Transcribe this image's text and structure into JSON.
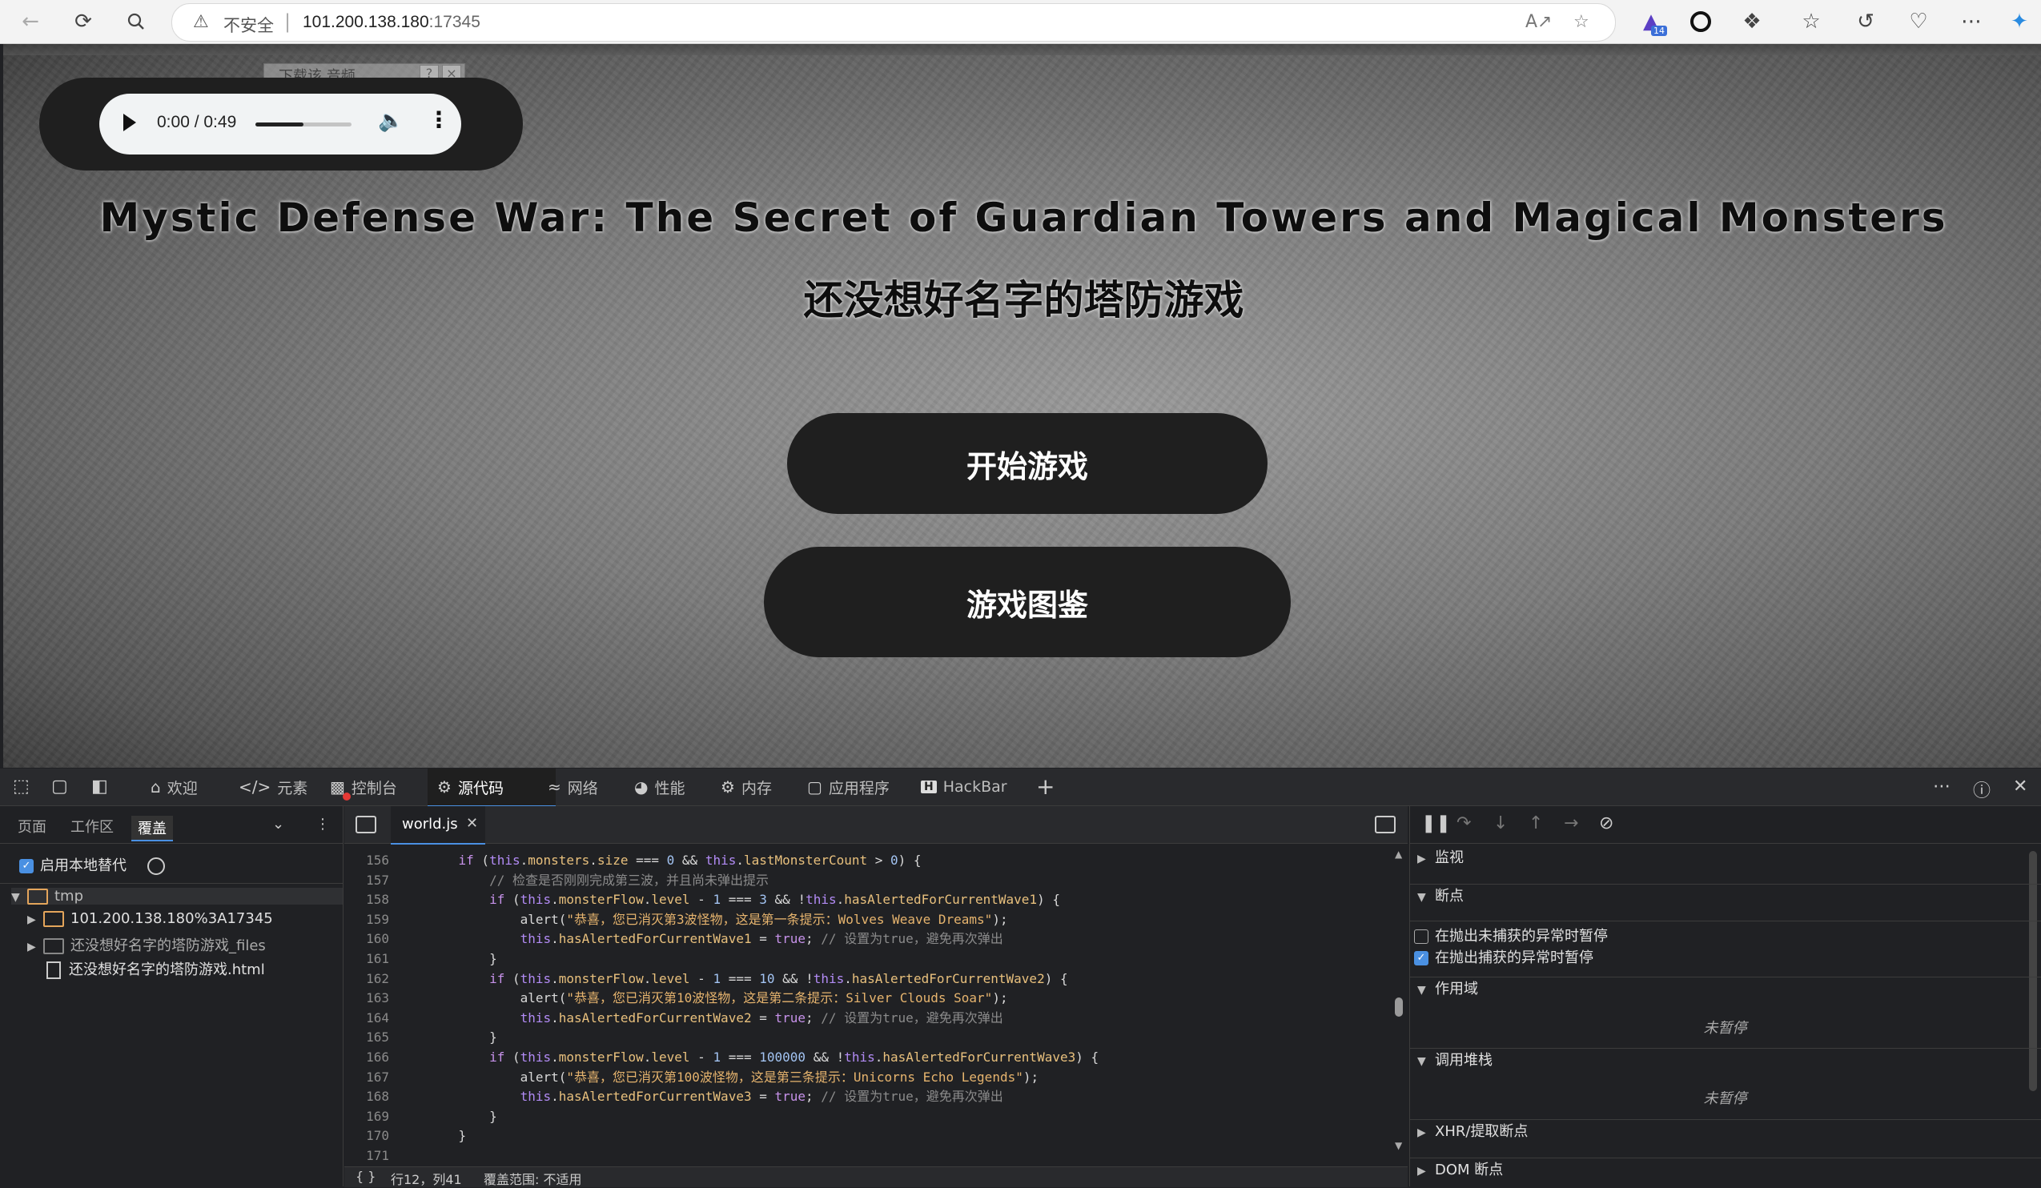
{
  "browser": {
    "insecure_label": "不安全",
    "separator": "|",
    "url_host": "101.200.138.180",
    "url_port": ":17345",
    "extension_badge": "14"
  },
  "page": {
    "audio_ghost_label": "下载该 音频",
    "audio_ghost_help": "?",
    "audio_ghost_close": "×",
    "audio_time": "0:00 / 0:49",
    "audio_volume_fraction": 0.5,
    "title_en": "Mystic Defense War: The Secret of Guardian Towers and Magical Monsters",
    "title_cn": "还没想好名字的塔防游戏",
    "start_button": "开始游戏",
    "gallery_button": "游戏图鉴"
  },
  "devtools": {
    "tabs": [
      {
        "label": "欢迎",
        "icon": "home-icon"
      },
      {
        "label": "元素",
        "icon": "code-icon"
      },
      {
        "label": "控制台",
        "icon": "console-icon"
      },
      {
        "label": "源代码",
        "icon": "bug-icon"
      },
      {
        "label": "网络",
        "icon": "wifi-icon"
      },
      {
        "label": "性能",
        "icon": "gauge-icon"
      },
      {
        "label": "内存",
        "icon": "memory-icon"
      },
      {
        "label": "应用程序",
        "icon": "app-icon"
      },
      {
        "label": "HackBar",
        "icon": "hackbar-icon"
      }
    ],
    "add_tab": "+",
    "nav_tabs": [
      "页面",
      "工作区",
      "覆盖"
    ],
    "enable_local_override": "启用本地替代",
    "tree": {
      "root": "tmp",
      "items": [
        "101.200.138.180%3A17345",
        "还没想好名字的塔防游戏_files",
        "还没想好名字的塔防游戏.html"
      ]
    },
    "editor_file": "world.js",
    "status": {
      "braces": "{ }",
      "position": "行12，列41",
      "coverage": "覆盖范围: 不适用"
    },
    "code_lines": [
      {
        "n": "156",
        "indent": 4,
        "segments": [
          [
            "kw",
            "if"
          ],
          [
            "op",
            " ("
          ],
          [
            "th",
            "this"
          ],
          [
            "op",
            "."
          ],
          [
            "pr",
            "monsters"
          ],
          [
            "op",
            "."
          ],
          [
            "pr",
            "size"
          ],
          [
            "op",
            " === "
          ],
          [
            "nu",
            "0"
          ],
          [
            "op",
            " && "
          ],
          [
            "th",
            "this"
          ],
          [
            "op",
            "."
          ],
          [
            "pr",
            "lastMonsterCount"
          ],
          [
            "op",
            " > "
          ],
          [
            "nu",
            "0"
          ],
          [
            "op",
            ") {"
          ]
        ]
      },
      {
        "n": "157",
        "indent": 8,
        "segments": [
          [
            "cm",
            "// 检查是否刚刚完成第三波，并且尚未弹出提示"
          ]
        ]
      },
      {
        "n": "158",
        "indent": 8,
        "segments": [
          [
            "kw",
            "if"
          ],
          [
            "op",
            " ("
          ],
          [
            "th",
            "this"
          ],
          [
            "op",
            "."
          ],
          [
            "pr",
            "monsterFlow"
          ],
          [
            "op",
            "."
          ],
          [
            "pr",
            "level"
          ],
          [
            "op",
            " - "
          ],
          [
            "nu",
            "1"
          ],
          [
            "op",
            " === "
          ],
          [
            "nu",
            "3"
          ],
          [
            "op",
            " && !"
          ],
          [
            "th",
            "this"
          ],
          [
            "op",
            "."
          ],
          [
            "pr",
            "hasAlertedForCurrentWave1"
          ],
          [
            "op",
            ") {"
          ]
        ]
      },
      {
        "n": "159",
        "indent": 12,
        "segments": [
          [
            "op",
            "alert("
          ],
          [
            "st",
            "\"恭喜，您已消灭第3波怪物，这是第一条提示：Wolves Weave Dreams\""
          ],
          [
            "op",
            ");"
          ]
        ]
      },
      {
        "n": "160",
        "indent": 12,
        "segments": [
          [
            "th",
            "this"
          ],
          [
            "op",
            "."
          ],
          [
            "pr",
            "hasAlertedForCurrentWave1"
          ],
          [
            "op",
            " = "
          ],
          [
            "kw",
            "true"
          ],
          [
            "op",
            "; "
          ],
          [
            "cm",
            "// 设置为true，避免再次弹出"
          ]
        ]
      },
      {
        "n": "161",
        "indent": 8,
        "segments": [
          [
            "op",
            "}"
          ]
        ]
      },
      {
        "n": "162",
        "indent": 8,
        "segments": [
          [
            "kw",
            "if"
          ],
          [
            "op",
            " ("
          ],
          [
            "th",
            "this"
          ],
          [
            "op",
            "."
          ],
          [
            "pr",
            "monsterFlow"
          ],
          [
            "op",
            "."
          ],
          [
            "pr",
            "level"
          ],
          [
            "op",
            " - "
          ],
          [
            "nu",
            "1"
          ],
          [
            "op",
            " === "
          ],
          [
            "nu",
            "10"
          ],
          [
            "op",
            " && !"
          ],
          [
            "th",
            "this"
          ],
          [
            "op",
            "."
          ],
          [
            "pr",
            "hasAlertedForCurrentWave2"
          ],
          [
            "op",
            ") {"
          ]
        ]
      },
      {
        "n": "163",
        "indent": 12,
        "segments": [
          [
            "op",
            "alert("
          ],
          [
            "st",
            "\"恭喜，您已消灭第10波怪物，这是第二条提示：Silver Clouds Soar\""
          ],
          [
            "op",
            ");"
          ]
        ]
      },
      {
        "n": "164",
        "indent": 12,
        "segments": [
          [
            "th",
            "this"
          ],
          [
            "op",
            "."
          ],
          [
            "pr",
            "hasAlertedForCurrentWave2"
          ],
          [
            "op",
            " = "
          ],
          [
            "kw",
            "true"
          ],
          [
            "op",
            "; "
          ],
          [
            "cm",
            "// 设置为true，避免再次弹出"
          ]
        ]
      },
      {
        "n": "165",
        "indent": 8,
        "segments": [
          [
            "op",
            "}"
          ]
        ]
      },
      {
        "n": "166",
        "indent": 8,
        "segments": [
          [
            "kw",
            "if"
          ],
          [
            "op",
            " ("
          ],
          [
            "th",
            "this"
          ],
          [
            "op",
            "."
          ],
          [
            "pr",
            "monsterFlow"
          ],
          [
            "op",
            "."
          ],
          [
            "pr",
            "level"
          ],
          [
            "op",
            " - "
          ],
          [
            "nu",
            "1"
          ],
          [
            "op",
            " === "
          ],
          [
            "nu",
            "100000"
          ],
          [
            "op",
            " && !"
          ],
          [
            "th",
            "this"
          ],
          [
            "op",
            "."
          ],
          [
            "pr",
            "hasAlertedForCurrentWave3"
          ],
          [
            "op",
            ") {"
          ]
        ]
      },
      {
        "n": "167",
        "indent": 12,
        "segments": [
          [
            "op",
            "alert("
          ],
          [
            "st",
            "\"恭喜，您已消灭第100波怪物，这是第三条提示：Unicorns Echo Legends\""
          ],
          [
            "op",
            ");"
          ]
        ]
      },
      {
        "n": "168",
        "indent": 12,
        "segments": [
          [
            "th",
            "this"
          ],
          [
            "op",
            "."
          ],
          [
            "pr",
            "hasAlertedForCurrentWave3"
          ],
          [
            "op",
            " = "
          ],
          [
            "kw",
            "true"
          ],
          [
            "op",
            "; "
          ],
          [
            "cm",
            "// 设置为true，避免再次弹出"
          ]
        ]
      },
      {
        "n": "169",
        "indent": 8,
        "segments": [
          [
            "op",
            "}"
          ]
        ]
      },
      {
        "n": "170",
        "indent": 4,
        "segments": [
          [
            "op",
            "}"
          ]
        ]
      },
      {
        "n": "171",
        "indent": 0,
        "segments": []
      }
    ],
    "debugger": {
      "watch": "监视",
      "breakpoints": "断点",
      "pause_uncaught": "在抛出未捕获的异常时暂停",
      "pause_caught": "在抛出捕获的异常时暂停",
      "pause_uncaught_checked": false,
      "pause_caught_checked": true,
      "scope": "作用域",
      "scope_status": "未暂停",
      "call_stack": "调用堆栈",
      "call_stack_status": "未暂停",
      "xhr": "XHR/提取断点",
      "dom": "DOM 断点"
    }
  }
}
